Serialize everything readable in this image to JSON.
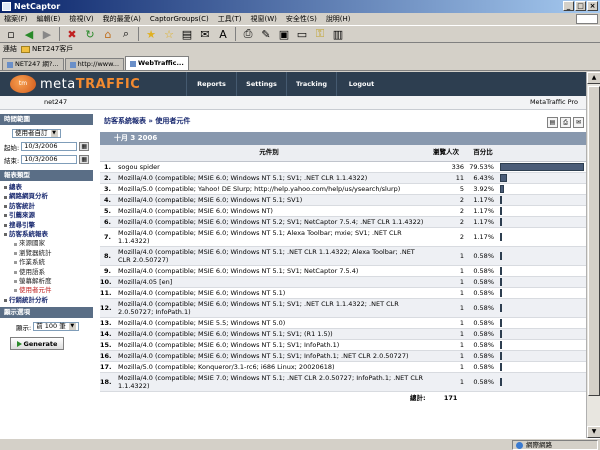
{
  "window": {
    "title": "NetCaptor",
    "buttons": [
      "_",
      "□",
      "×"
    ]
  },
  "menu": [
    "檔案(F)",
    "編輯(E)",
    "檢視(V)",
    "我的最愛(A)",
    "CaptorGroups(C)",
    "工具(T)",
    "視窗(W)",
    "安全性(S)",
    "說明(H)"
  ],
  "links_bar": {
    "label": "連結",
    "folder": "NET247客戶"
  },
  "tabs": [
    {
      "label": "NET247 網?..."
    },
    {
      "label": "http://www..."
    },
    {
      "label": "WebTraffic..."
    }
  ],
  "header": {
    "logo_mark": "tm",
    "logo_word1": "meta",
    "logo_word2": "TRAFFIC",
    "nav": [
      "Reports",
      "Settings",
      "Tracking",
      "Logout"
    ],
    "site": "net247",
    "product": "MetaTraffic Pro"
  },
  "sidebar": {
    "time_period": {
      "title": "時間範圍",
      "range_select": "使用者自訂",
      "start_label": "起始:",
      "start_date": "10/3/2006",
      "end_label": "結束:",
      "end_date": "10/3/2006"
    },
    "report_type": {
      "title": "報表類型",
      "items": [
        {
          "label": "總表",
          "sub": false
        },
        {
          "label": "網路網頁分析",
          "sub": false
        },
        {
          "label": "訪客統計",
          "sub": false
        },
        {
          "label": "引薦來源",
          "sub": false
        },
        {
          "label": "搜尋引擎",
          "sub": false
        },
        {
          "label": "訪客系統報表",
          "sub": false
        },
        {
          "label": "來源國家",
          "sub": true
        },
        {
          "label": "瀏覽器統計",
          "sub": true
        },
        {
          "label": "作業系統",
          "sub": true
        },
        {
          "label": "使用語系",
          "sub": true
        },
        {
          "label": "螢幕解析度",
          "sub": true
        },
        {
          "label": "使用者元件",
          "sub": true,
          "current": true
        },
        {
          "label": "行銷統計分析",
          "sub": false
        }
      ]
    },
    "display_options": {
      "title": "顯示選項",
      "show_label": "顯示:",
      "show_value": "前 100 筆"
    },
    "generate_button": "Generate"
  },
  "main": {
    "breadcrumb": "訪客系統報表 » 使用者元件",
    "date_header": "十月 3 2006",
    "columns": {
      "index": "",
      "agent": "元件別",
      "visitors": "瀏覽人次",
      "percent": "百分比",
      "bar": ""
    },
    "rows": [
      {
        "n": "1.",
        "agent": "sogou spider",
        "visitors": "336",
        "percent": "79.53%"
      },
      {
        "n": "2.",
        "agent": "Mozilla/4.0 (compatible; MSIE 6.0; Windows NT 5.1; SV1; .NET CLR 1.1.4322)",
        "visitors": "11",
        "percent": "6.43%"
      },
      {
        "n": "3.",
        "agent": "Mozilla/5.0 (compatible; Yahoo! DE Slurp; http://help.yahoo.com/help/us/ysearch/slurp)",
        "visitors": "5",
        "percent": "3.92%"
      },
      {
        "n": "4.",
        "agent": "Mozilla/4.0 (compatible; MSIE 6.0; Windows NT 5.1; SV1)",
        "visitors": "2",
        "percent": "1.17%"
      },
      {
        "n": "5.",
        "agent": "Mozilla/4.0 (compatible; MSIE 6.0; Windows NT)",
        "visitors": "2",
        "percent": "1.17%"
      },
      {
        "n": "6.",
        "agent": "Mozilla/4.0 (compatible; MSIE 6.0; Windows NT 5.2; SV1; NetCaptor 7.5.4; .NET CLR 1.1.4322)",
        "visitors": "2",
        "percent": "1.17%"
      },
      {
        "n": "7.",
        "agent": "Mozilla/4.0 (compatible; MSIE 6.0; Windows NT 5.1; Alexa Toolbar; mxie; SV1; .NET CLR 1.1.4322)",
        "visitors": "2",
        "percent": "1.17%"
      },
      {
        "n": "8.",
        "agent": "Mozilla/4.0 (compatible; MSIE 6.0; Windows NT 5.1; .NET CLR 1.1.4322; Alexa Toolbar; .NET CLR 2.0.50727)",
        "visitors": "1",
        "percent": "0.58%"
      },
      {
        "n": "9.",
        "agent": "Mozilla/4.0 (compatible; MSIE 6.0; Windows NT 5.1; SV1; NetCaptor 7.5.4)",
        "visitors": "1",
        "percent": "0.58%"
      },
      {
        "n": "10.",
        "agent": "Mozilla/4.05 [en]",
        "visitors": "1",
        "percent": "0.58%"
      },
      {
        "n": "11.",
        "agent": "Mozilla/4.0 (compatible; MSIE 6.0; Windows NT 5.1)",
        "visitors": "1",
        "percent": "0.58%"
      },
      {
        "n": "12.",
        "agent": "Mozilla/4.0 (compatible; MSIE 6.0; Windows NT 5.1; SV1; .NET CLR 1.1.4322; .NET CLR 2.0.50727; InfoPath.1)",
        "visitors": "1",
        "percent": "0.58%"
      },
      {
        "n": "13.",
        "agent": "Mozilla/4.0 (compatible; MSIE 5.5; Windows NT 5.0)",
        "visitors": "1",
        "percent": "0.58%"
      },
      {
        "n": "14.",
        "agent": "Mozilla/4.0 (compatible; MSIE 6.0; Windows NT 5.1; SV1; (R1 1.5))",
        "visitors": "1",
        "percent": "0.58%"
      },
      {
        "n": "15.",
        "agent": "Mozilla/4.0 (compatible; MSIE 6.0; Windows NT 5.1; SV1; InfoPath.1)",
        "visitors": "1",
        "percent": "0.58%"
      },
      {
        "n": "16.",
        "agent": "Mozilla/4.0 (compatible; MSIE 6.0; Windows NT 5.1; SV1; InfoPath.1; .NET CLR 2.0.50727)",
        "visitors": "1",
        "percent": "0.58%"
      },
      {
        "n": "17.",
        "agent": "Mozilla/5.0 (compatible; Konqueror/3.1-rc6; i686 Linux; 20020618)",
        "visitors": "1",
        "percent": "0.58%"
      },
      {
        "n": "18.",
        "agent": "Mozilla/4.0 (compatible; MSIE 7.0; Windows NT 5.1; .NET CLR 2.0.50727; InfoPath.1; .NET CLR 1.1.4322)",
        "visitors": "1",
        "percent": "0.58%"
      }
    ],
    "total_label": "總計:",
    "total_value": "171"
  },
  "status": {
    "zone": "網際網路"
  },
  "colors": {
    "header_bg": "#2d3e50",
    "accent": "#f28a30",
    "section_head": "#5a6e86",
    "bar": "#4a5c78"
  }
}
